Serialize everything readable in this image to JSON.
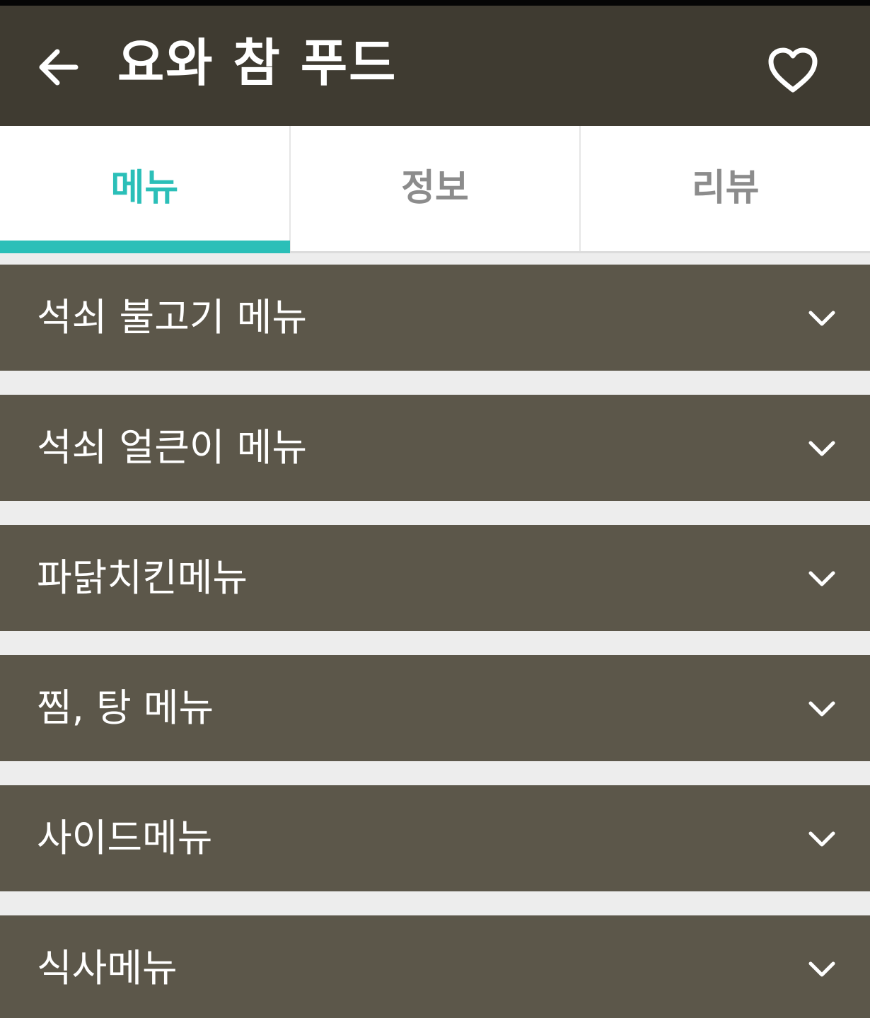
{
  "header": {
    "title": "요와 참 푸드",
    "back_icon": "arrow-left-icon",
    "favorite_icon": "heart-outline-icon"
  },
  "tabs": [
    {
      "label": "메뉴",
      "active": true
    },
    {
      "label": "정보",
      "active": false
    },
    {
      "label": "리뷰",
      "active": false
    }
  ],
  "categories": [
    {
      "label": "석쇠 불고기 메뉴"
    },
    {
      "label": "석쇠 얼큰이 메뉴"
    },
    {
      "label": "파닭치킨메뉴"
    },
    {
      "label": "찜, 탕 메뉴"
    },
    {
      "label": "사이드메뉴"
    },
    {
      "label": "식사메뉴"
    }
  ],
  "colors": {
    "app_bar": "#3f3b31",
    "accent": "#2bbfb8",
    "category_bg": "#5c574a",
    "page_bg": "#ededed"
  }
}
